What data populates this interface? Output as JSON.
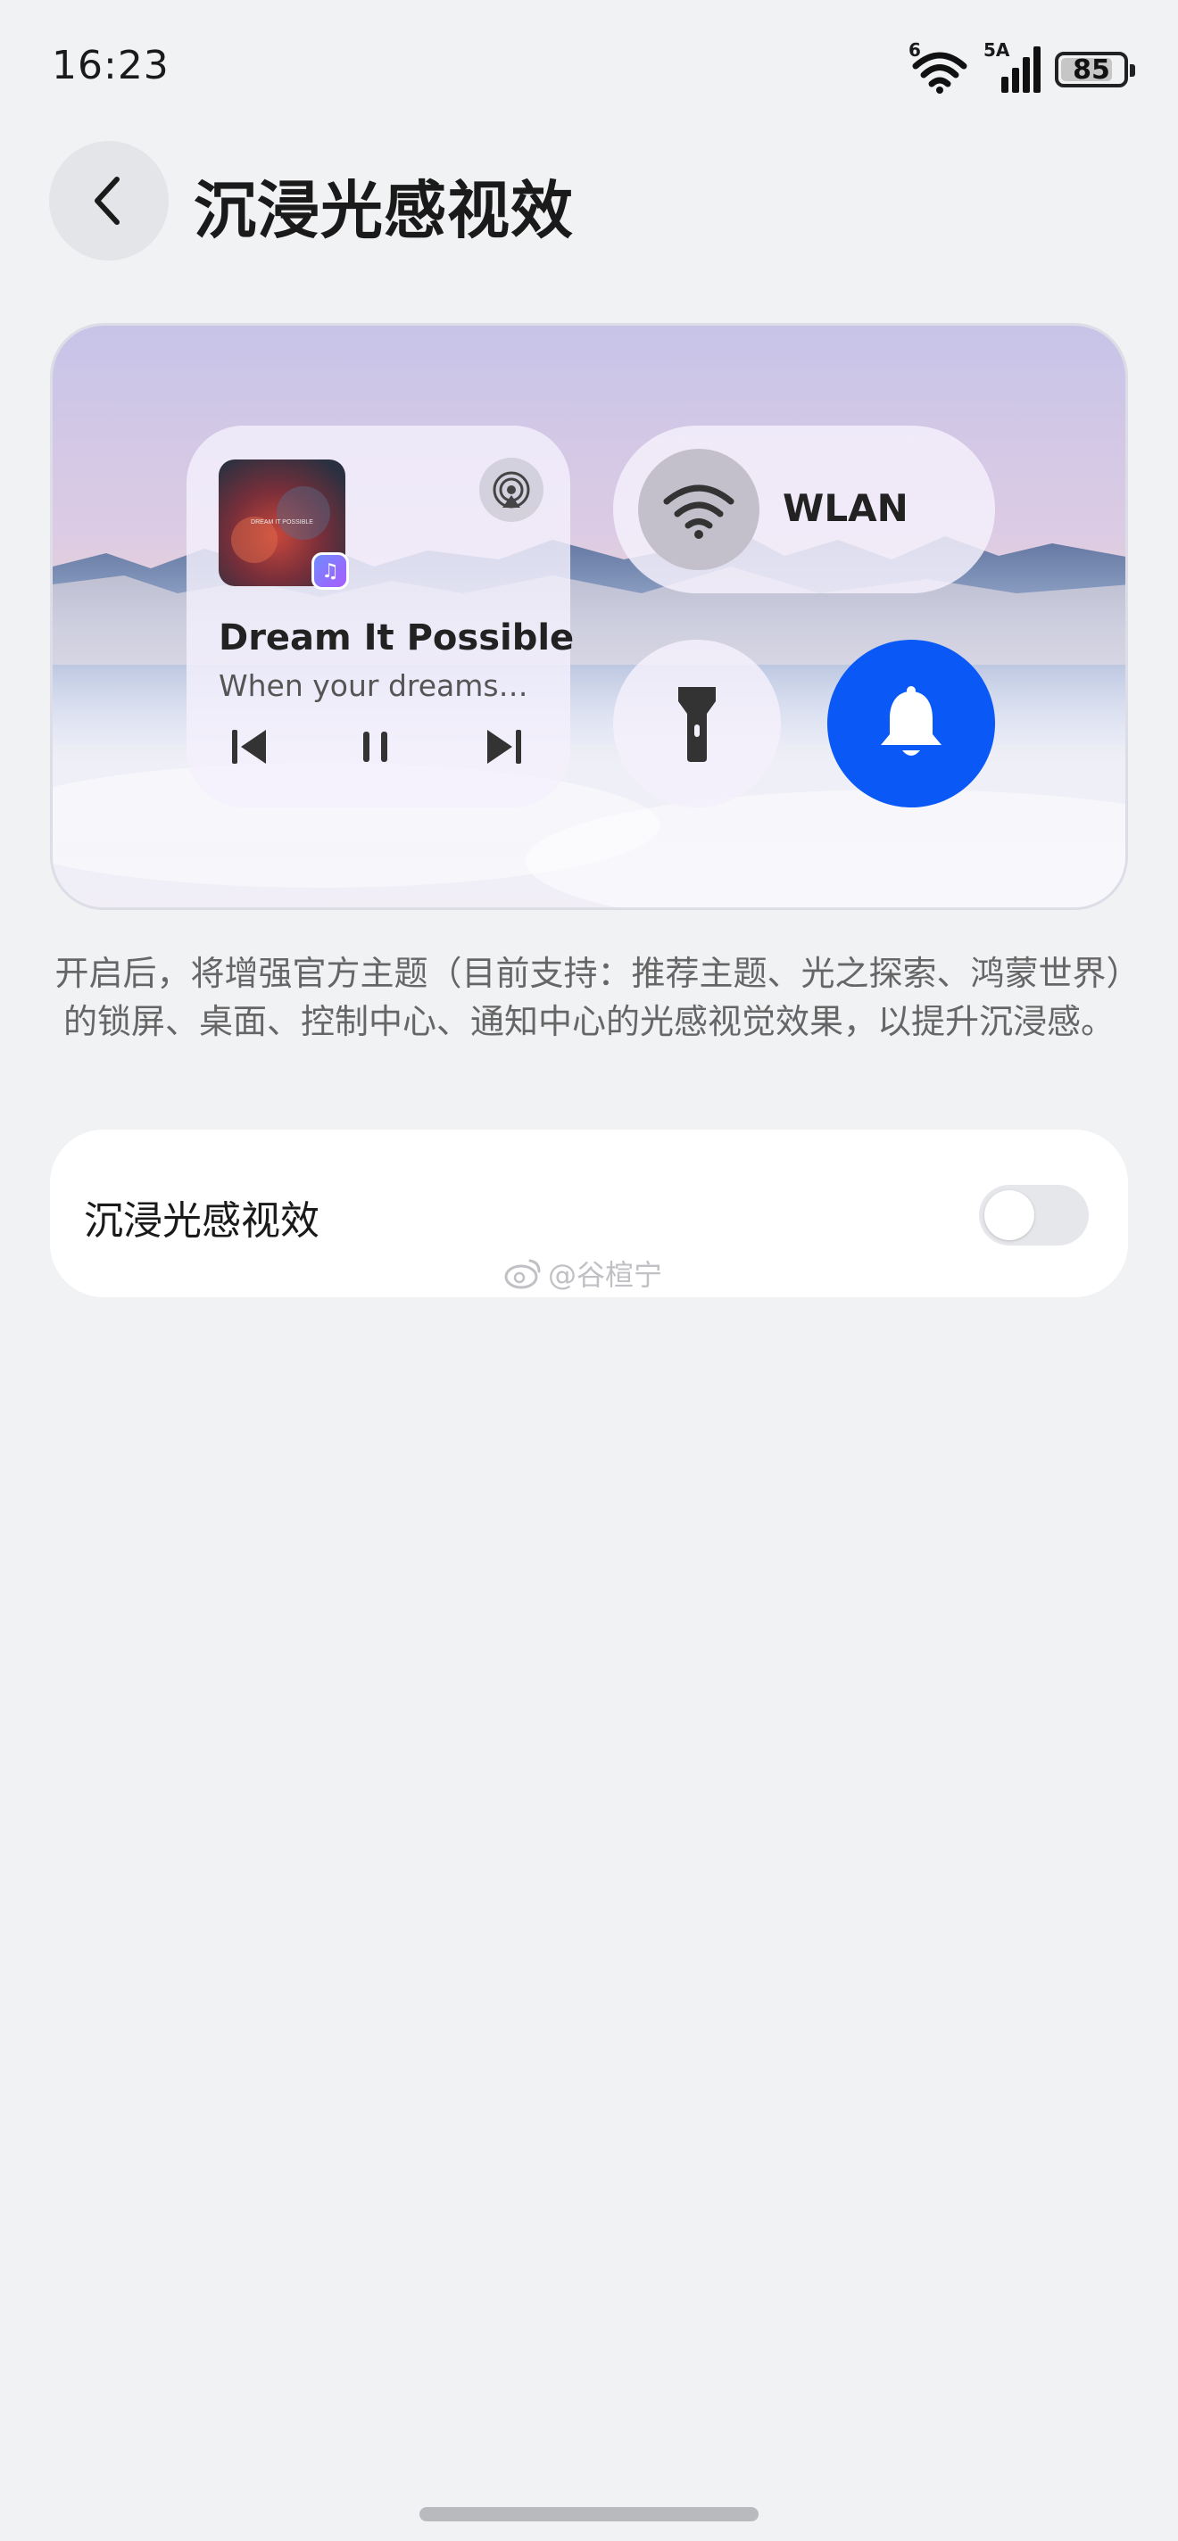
{
  "status_bar": {
    "time": "16:23",
    "wifi_tag": "6",
    "signal_tag": "5A",
    "battery": "85",
    "battery_level": 0.85
  },
  "header": {
    "back_icon": "chevron-left-icon",
    "title": "沉浸光感视效"
  },
  "preview": {
    "music": {
      "album_text": "DREAM IT POSSIBLE",
      "song_title": "Dream It Possible",
      "song_subtitle": "When your dreams…",
      "icons": [
        "previous-icon",
        "pause-icon",
        "next-icon",
        "cast-icon",
        "music-app-icon"
      ]
    },
    "wlan_label": "WLAN",
    "wlan_icon": "wifi-icon",
    "torch_icon": "flashlight-icon",
    "bell_icon": "bell-icon",
    "colors": {
      "accent": "#0a59f7"
    }
  },
  "description": "开启后，将增强官方主题（目前支持：推荐主题、光之探索、鸿蒙世界）的锁屏、桌面、控制中心、通知中心的光感视觉效果，以提升沉浸感。",
  "setting": {
    "label": "沉浸光感视效",
    "enabled": false
  },
  "watermark": "@谷楦宁"
}
